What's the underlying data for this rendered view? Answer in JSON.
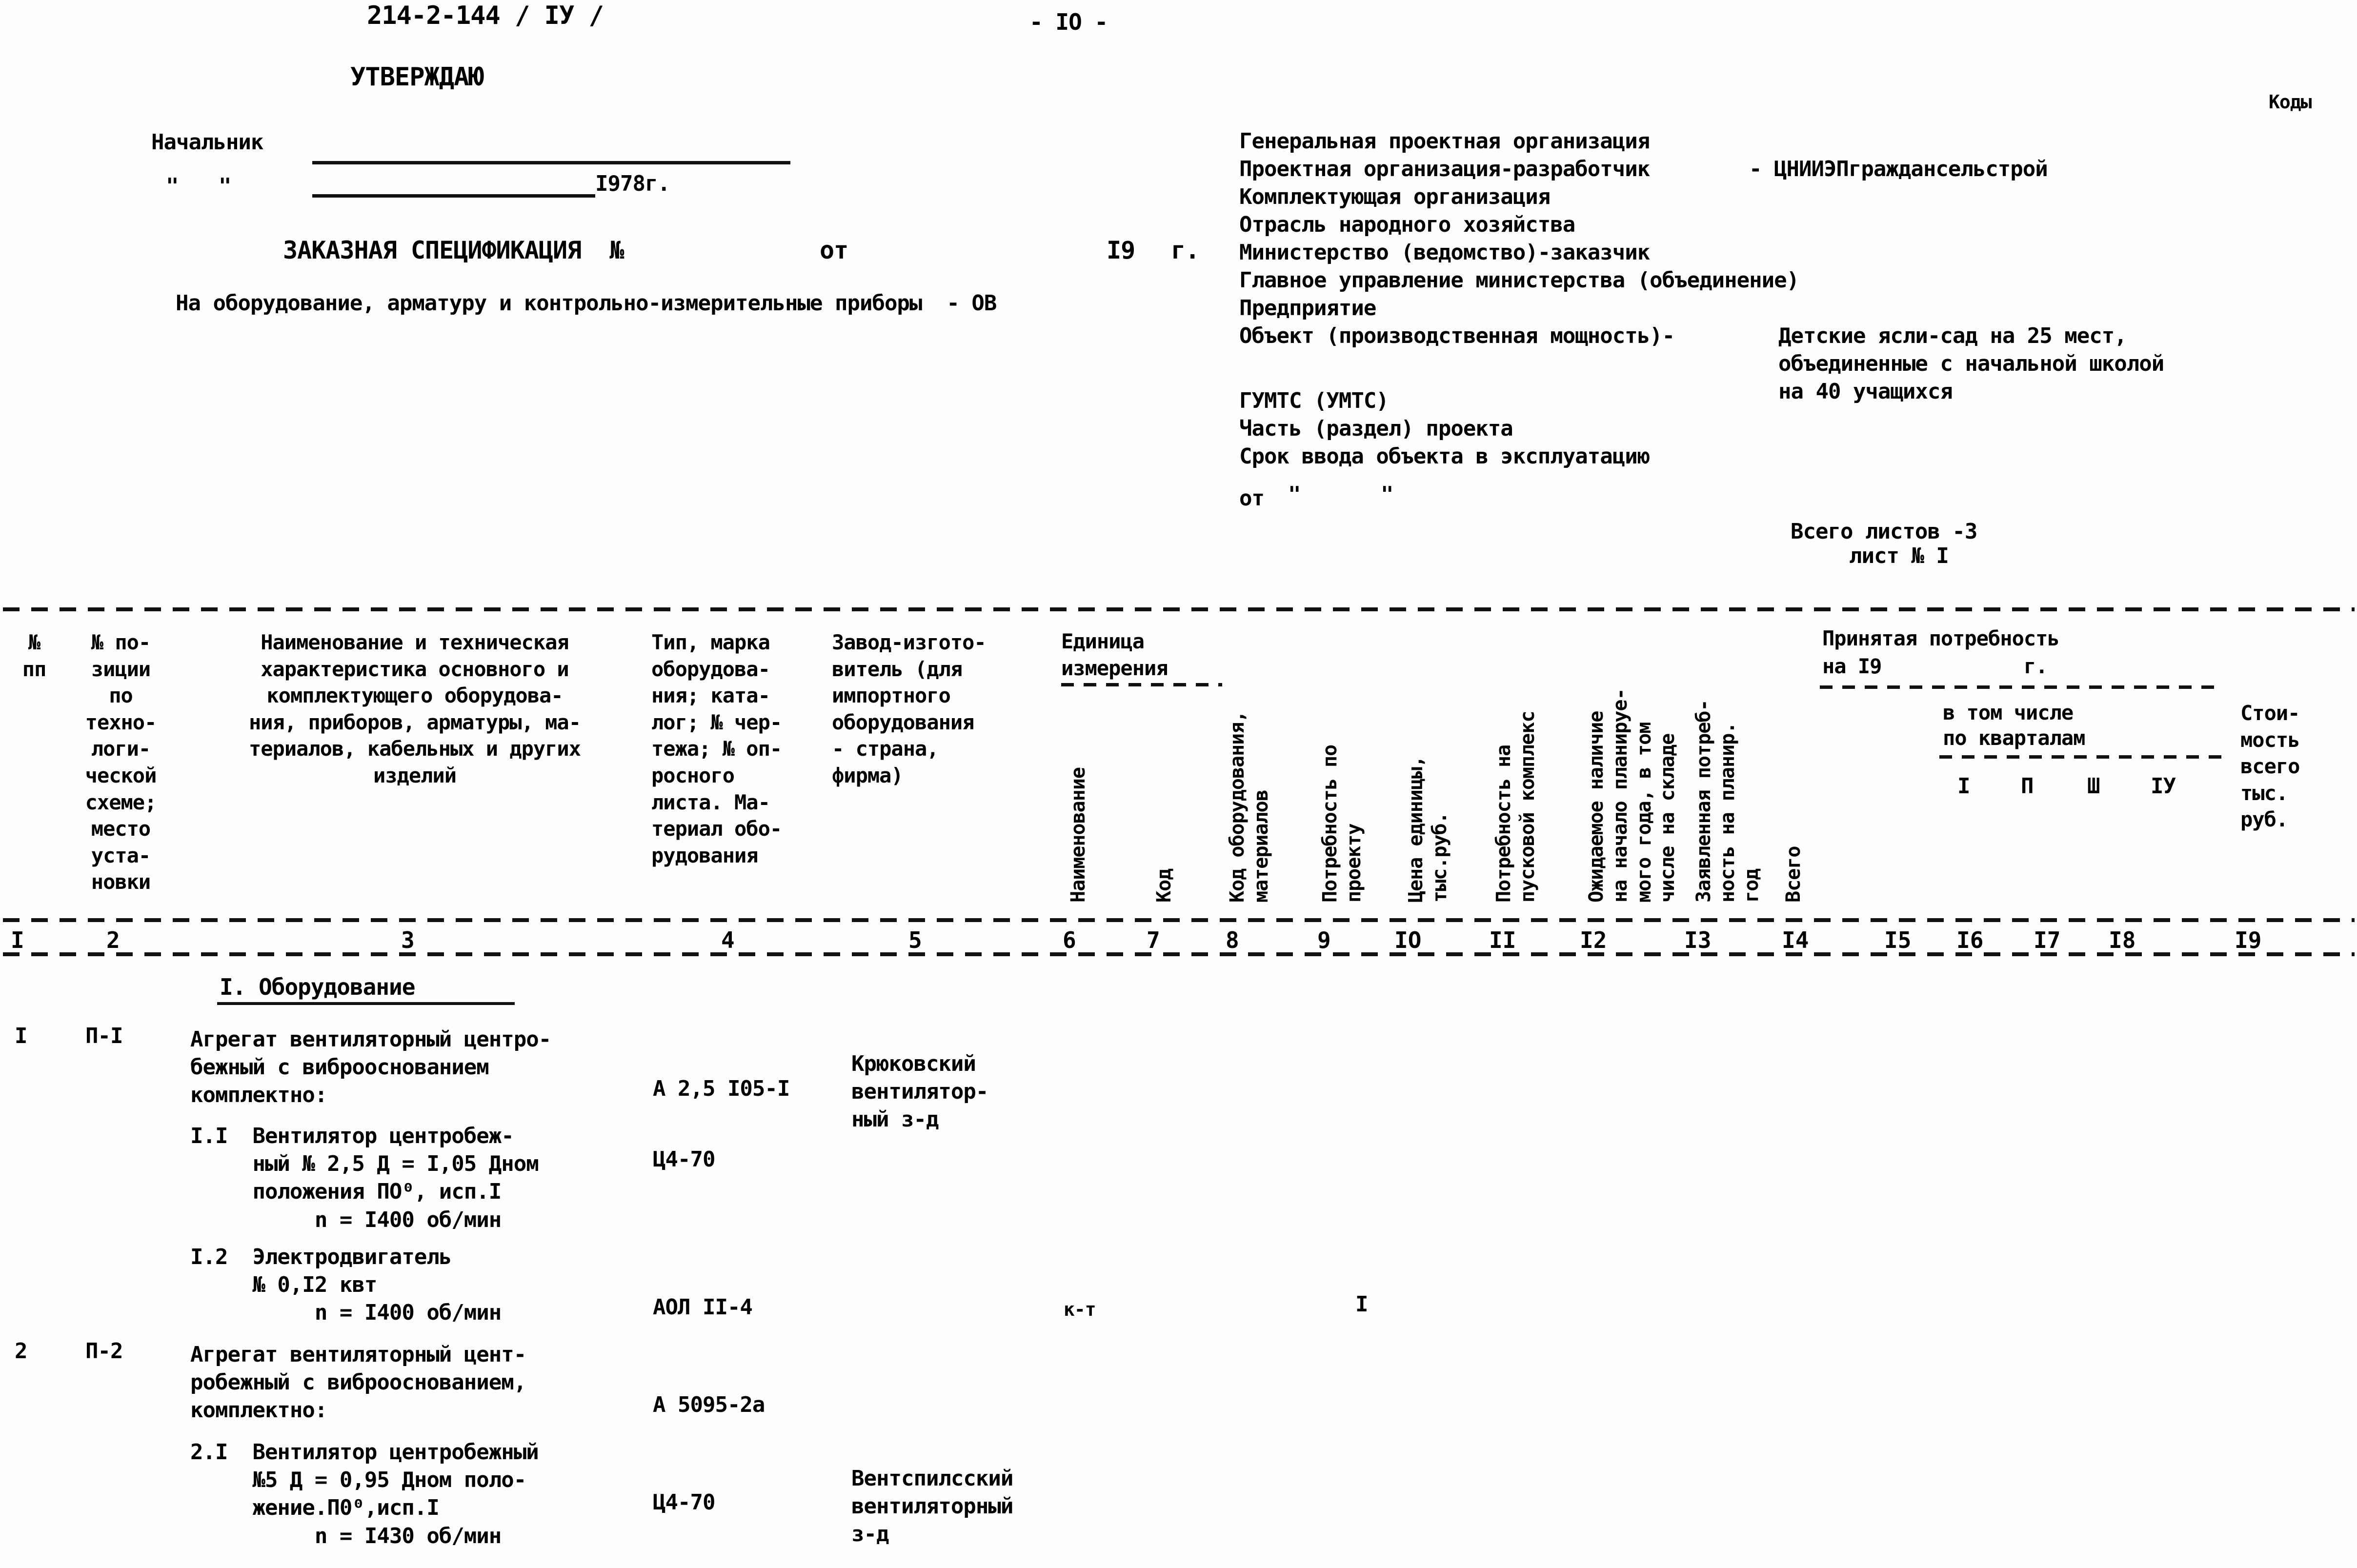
{
  "document": {
    "doc_number": "214-2-144 / IУ /",
    "page_label": "- IО -",
    "codes_label": "Коды",
    "approve_label": "УТВЕРЖДАЮ",
    "chief_label": "Начальник",
    "date_quote_open": "\"",
    "date_quote_close": "\"",
    "year_suffix": "I978г.",
    "spec_title": "ЗАКАЗНАЯ СПЕЦИФИКАЦИЯ  №",
    "spec_from": "от",
    "spec_year": "I9",
    "spec_year_suffix": "г.",
    "subject_line": "На оборудование, арматуру и контрольно-измерительные приборы  - ОВ",
    "total_sheets": "Всего листов -3",
    "sheet_no": "лист № I"
  },
  "org_fields": [
    {
      "label": "Генеральная проектная организация",
      "value": ""
    },
    {
      "label": "Проектная организация-разработчик",
      "value": "- ЦНИИЭПграждансельстрой"
    },
    {
      "label": "Комплектующая организация",
      "value": ""
    },
    {
      "label": "Отрасль народного хозяйства",
      "value": ""
    },
    {
      "label": "Министерство (ведомство)-заказчик",
      "value": ""
    },
    {
      "label": "Главное управление министерства (объединение)",
      "value": ""
    },
    {
      "label": "Предприятие",
      "value": ""
    },
    {
      "label": "Объект (производственная мощность)-",
      "value": ""
    }
  ],
  "object_value": {
    "line1": "Детские ясли-сад на 25 мест,",
    "line2": "объединенные с начальной школой",
    "line3": "на 40 учащихся"
  },
  "org_fields_2": [
    {
      "label": "ГУМТС (УМТС)"
    },
    {
      "label": "Часть (раздел) проекта"
    },
    {
      "label": "Срок ввода объекта в эксплуатацию"
    }
  ],
  "from_line": {
    "prefix": "от",
    "quote_open": "\"",
    "quote_close": "\""
  },
  "table": {
    "headers": {
      "col1": "№\nпп",
      "col2": "№ по-\nзиции\nпо\nтехно-\nлоги-\nческой\nсхеме;\nместо\nуста-\nновки",
      "col3": "Наименование и техническая\nхарактеристика основного и\nкомплектующего оборудова-\nния, приборов, арматуры, ма-\nтериалов, кабельных и других\nизделий",
      "col4": "Тип, марка\nоборудова-\nния; ката-\nлог; № чер-\nтежа; № оп-\nросного\nлиста. Ма-\nтериал обо-\nрудования",
      "col5": "Завод-изгото-\nвитель (для\nимпортного\nоборудования\n- страна,\nфирма)",
      "unit_group": "Единица\nизмерения",
      "col6": "Наименование",
      "col7": "Код",
      "col8": "Код оборудования,\nматериалов",
      "col9": "Потребность по\nпроекту",
      "col10": "Цена единицы,\nтыс.руб.",
      "col11": "Потребность на\nпусковой комплекс",
      "col12": "Ожидаемое наличие\nна начало планируе-\nмого года, в том\nчисле на складе",
      "col13": "Заявленная потреб-\nность на планир.\nгод",
      "col14": "Всего",
      "accepted_group_l1": "Принятая потребность",
      "accepted_group_l2": "на I9            г.",
      "quarters_group_l1": "в том числе",
      "quarters_group_l2": "по кварталам",
      "q1": "I",
      "q2": "П",
      "q3": "Ш",
      "q4": "IУ",
      "col19": "Стои-\nмость\nвсего\nтыс.\nруб."
    },
    "column_numbers": [
      "I",
      "2",
      "3",
      "4",
      "5",
      "6",
      "7",
      "8",
      "9",
      "IО",
      "II",
      "I2",
      "I3",
      "I4",
      "I5",
      "I6",
      "I7",
      "I8",
      "I9"
    ],
    "section_title": "I. Оборудование",
    "rows": [
      {
        "no": "I",
        "position": "П-I",
        "name": "Агрегат вентиляторный центро-\nбежный с виброоснованием\nкомплектно:",
        "type": "А 2,5 I05-I",
        "maker": "Крюковский\nвентилятор-\nный з-д",
        "unit_name": "",
        "unit_code": "",
        "equip_code": "",
        "need_project": ""
      },
      {
        "no": "",
        "position": "",
        "name": "I.I  Вентилятор центробеж-\n     ный № 2,5 Д = I,05 Дном\n     положения ПО⁰, исп.I\n          n = I400 об/мин",
        "type": "Ц4-70",
        "maker": "",
        "unit_name": "",
        "unit_code": "",
        "equip_code": "",
        "need_project": ""
      },
      {
        "no": "",
        "position": "",
        "name": "I.2  Электродвигатель\n     № 0,I2 квт\n          n = I400 об/мин",
        "type": "АОЛ II-4",
        "maker": "",
        "unit_name": "к-т",
        "unit_code": "",
        "equip_code": "",
        "need_project": "I"
      },
      {
        "no": "2",
        "position": "П-2",
        "name": "Агрегат вентиляторный цент-\nробежный с виброоснованием,\nкомплектно:",
        "type": "А 5095-2а",
        "maker": "",
        "unit_name": "",
        "unit_code": "",
        "equip_code": "",
        "need_project": ""
      },
      {
        "no": "",
        "position": "",
        "name": "2.I  Вентилятор центробежный\n     №5 Д = 0,95 Дном поло-\n     жение.П0⁰,исп.I\n          n = I430 об/мин",
        "type": "Ц4-70",
        "maker": "Вентспилсский\nвентиляторный\nз-д",
        "unit_name": "",
        "unit_code": "",
        "equip_code": "",
        "need_project": ""
      }
    ]
  }
}
